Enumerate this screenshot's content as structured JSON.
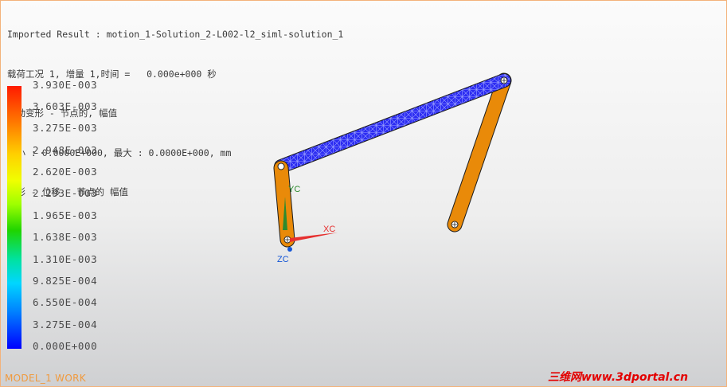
{
  "viewport": {
    "header_lines": [
      "Imported Result : motion_1-Solution_2-L002-l2_siml-solution_1",
      "载荷工况 1, 增量 1,时间 =   0.000e+000 秒",
      "平动变形 - 节点的, 幅值",
      "最小 : 0.0000E+000, 最大 : 0.0000E+000, mm",
      "变形 - 位移 - 节点的 幅值"
    ],
    "legend_values": [
      "3.930E-003",
      "3.603E-003",
      "3.275E-003",
      "2.948E-003",
      "2.620E-003",
      "2.293E-003",
      "1.965E-003",
      "1.638E-003",
      "1.310E-003",
      "9.825E-004",
      "6.550E-004",
      "3.275E-004",
      "0.000E+000"
    ],
    "axes": {
      "x_label": "XC",
      "y_label": "YC",
      "z_label": "ZC"
    },
    "footer_label": "MODEL_1 WORK",
    "watermark": "三维网www.3dportal.cn"
  },
  "colors": {
    "link_orange": "#e98a09",
    "mesh_blue": "#2c2cf2",
    "mesh_line": "#9aa0ff",
    "x_axis": "#e6302f",
    "y_axis": "#2e8b2e",
    "z_axis": "#1456d6",
    "frame": "#f3b27a"
  },
  "icons": [
    "pin-joint-icon",
    "coordinate-triad-icon"
  ]
}
